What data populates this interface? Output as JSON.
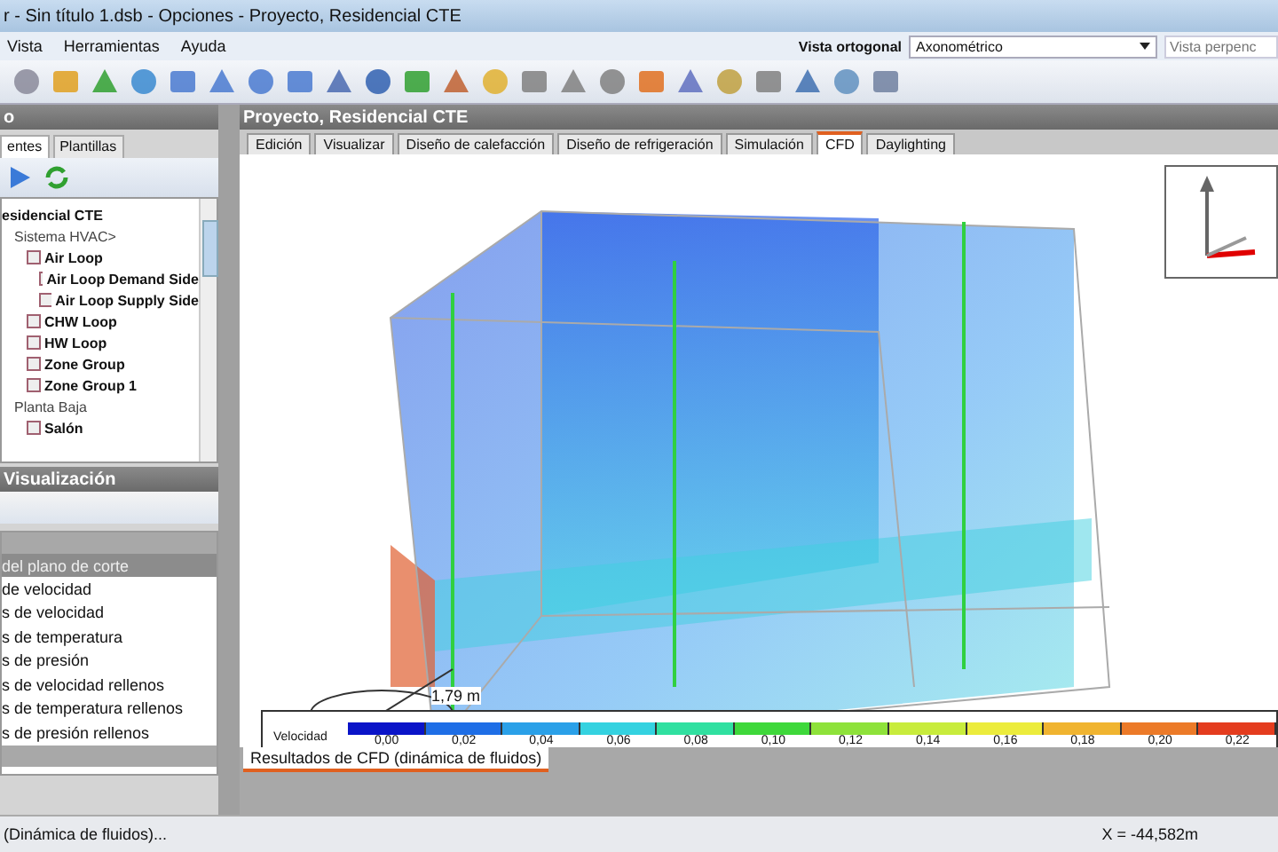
{
  "window": {
    "title": "r - Sin título 1.dsb - Opciones - Proyecto, Residencial CTE"
  },
  "menu": [
    "Vista",
    "Herramientas",
    "Ayuda"
  ],
  "view_selector": {
    "label": "Vista ortogonal",
    "value": "Axonométrico",
    "placeholder": "Vista perpenc"
  },
  "left_panel": {
    "title": "o",
    "tabs": [
      {
        "label": "entes",
        "selected": true
      },
      {
        "label": "Plantillas",
        "selected": false
      }
    ],
    "tree": [
      {
        "label": "esidencial CTE",
        "bold": true,
        "children": [
          {
            "label": "Sistema HVAC>",
            "bold": false,
            "children": [
              {
                "label": "Air Loop",
                "bold": true,
                "children": [
                  {
                    "label": "Air Loop Demand Side",
                    "bold": true
                  },
                  {
                    "label": "Air Loop Supply Side",
                    "bold": true
                  }
                ]
              },
              {
                "label": "CHW Loop",
                "bold": true
              },
              {
                "label": "HW Loop",
                "bold": true
              },
              {
                "label": "Zone Group",
                "bold": true
              },
              {
                "label": "Zone Group 1",
                "bold": true
              }
            ]
          },
          {
            "label": "Planta Baja",
            "bold": false,
            "children": [
              {
                "label": "Salón",
                "bold": true
              }
            ]
          }
        ]
      }
    ],
    "section_title": "Visualización",
    "list_header": "del plano de corte",
    "list_items": [
      "de velocidad",
      "s de velocidad",
      "s de temperatura",
      "s de presión",
      "s de velocidad rellenos",
      "s de temperatura rellenos",
      "s de presión rellenos"
    ]
  },
  "main": {
    "title": "Proyecto, Residencial CTE",
    "tabs": [
      {
        "label": "Edición",
        "selected": false
      },
      {
        "label": "Visualizar",
        "selected": false
      },
      {
        "label": "Diseño de calefacción",
        "selected": false
      },
      {
        "label": "Diseño de refrigeración",
        "selected": false
      },
      {
        "label": "Simulación",
        "selected": false
      },
      {
        "label": "CFD",
        "selected": true
      },
      {
        "label": "Daylighting",
        "selected": false
      }
    ],
    "dimension_label": "1,79 m",
    "legend": {
      "label": "Velocidad",
      "ticks": [
        "0,00",
        "0,02",
        "0,04",
        "0,06",
        "0,08",
        "0,10",
        "0,12",
        "0,14",
        "0,16",
        "0,18",
        "0,20",
        "0,22"
      ]
    },
    "bottom_tab": "Resultados de CFD (dinámica de fluidos)"
  },
  "status_bar": {
    "left": "(Dinámica de fluidos)...",
    "right": "X = -44,582m"
  }
}
